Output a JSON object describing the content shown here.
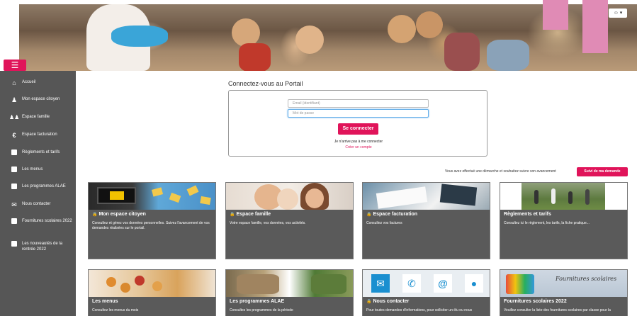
{
  "header": {
    "user_menu_label": "☰ ▾"
  },
  "menu_toggle": "☰",
  "sidebar": {
    "items": [
      {
        "label": "Accueil",
        "icon": "home-icon"
      },
      {
        "label": "Mon espace citoyen",
        "icon": "user-icon"
      },
      {
        "label": "Espace famille",
        "icon": "family-icon"
      },
      {
        "label": "Espace facturation",
        "icon": "euro-icon"
      },
      {
        "label": "Règlements et tarifs",
        "icon": "square-icon"
      },
      {
        "label": "Les menus",
        "icon": "square-icon"
      },
      {
        "label": "Les programmes ALAE",
        "icon": "square-icon"
      },
      {
        "label": "Nous contacter",
        "icon": "mail-icon"
      },
      {
        "label": "Fournitures scolaires 2022",
        "icon": "square-icon"
      },
      {
        "label": "Les nouveautés de la rentrée 2022",
        "icon": "square-icon"
      }
    ]
  },
  "login": {
    "title": "Connectez-vous au Portail",
    "email_placeholder": "Email (identifiant)",
    "password_placeholder": "Mot de passe",
    "submit_label": "Se connecter",
    "no_access": "Je n'arrive pas à me connecter",
    "create_account": "Créer un compte"
  },
  "follow": {
    "text": "Vous avez effectué une démarche et souhaitez suivre son avancement",
    "button": "Suivi de ma demande"
  },
  "cards": [
    {
      "title": "Mon espace citoyen",
      "locked": true,
      "desc": "Consultez et gérez vos données personnelles. Suivez l'avancement de vos demandes réalisées sur le portail."
    },
    {
      "title": "Espace famille",
      "locked": true,
      "desc": "Votre espace famille, vos données, vos activités."
    },
    {
      "title": "Espace facturation",
      "locked": true,
      "desc": "Consultez vos factures"
    },
    {
      "title": "Règlements et tarifs",
      "locked": false,
      "desc": "Consultez ici le règlement, les tarifs, la fiche pratique..."
    },
    {
      "title": "Les menus",
      "locked": false,
      "desc": "Consultez les menus du mois"
    },
    {
      "title": "Les programmes ALAE",
      "locked": false,
      "desc": "Consultez les programmes de la période"
    },
    {
      "title": "Nous contacter",
      "locked": true,
      "desc": "Pour toutes demandes d'informations, pour solliciter un élu ou nous"
    },
    {
      "title": "Fournitures scolaires 2022",
      "locked": false,
      "desc": "Veuillez consulter la liste des fournitures scolaires par classe pour la"
    }
  ],
  "card4_img_text": "Fournitures scolaires",
  "colors": {
    "accent": "#e0145a",
    "sidebar": "#565656",
    "card": "#5a5a5a"
  }
}
